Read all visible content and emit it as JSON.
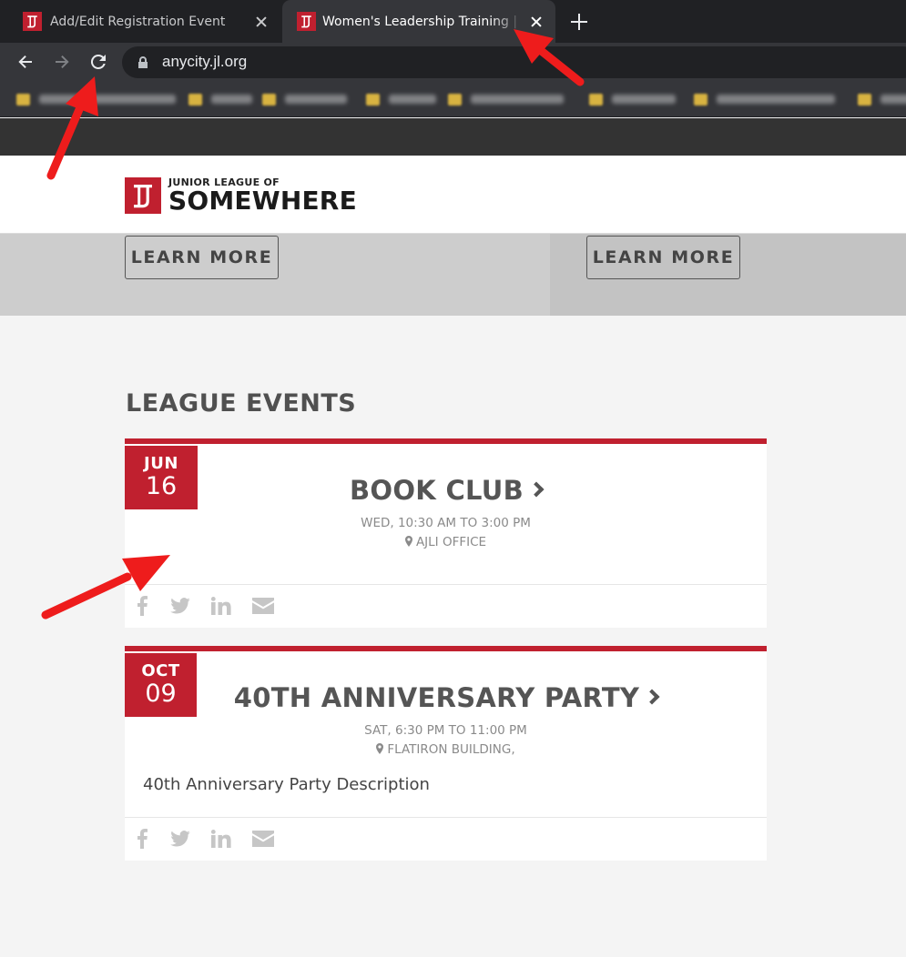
{
  "browser": {
    "tabs": [
      {
        "title": "Add/Edit Registration Event",
        "active": false
      },
      {
        "title": "Women's Leadership Training | FL",
        "active": true
      }
    ],
    "url": "anycity.jl.org",
    "bookmarks_blurred": true
  },
  "site": {
    "logo": {
      "line1": "JUNIOR LEAGUE OF",
      "line2": "SOMEWHERE"
    },
    "promo_buttons": [
      "LEARN MORE",
      "LEARN MORE"
    ],
    "events_heading": "LEAGUE EVENTS",
    "events": [
      {
        "month": "JUN",
        "day": "16",
        "title": "BOOK CLUB",
        "time": "WED, 10:30 AM TO 3:00 PM",
        "location": "AJLI OFFICE",
        "description": ""
      },
      {
        "month": "OCT",
        "day": "09",
        "title": "40TH ANNIVERSARY PARTY",
        "time": "SAT, 6:30 PM TO 11:00 PM",
        "location": "FLATIRON BUILDING,",
        "description": "40th Anniversary Party Description"
      }
    ],
    "share_icons": [
      "facebook-icon",
      "twitter-icon",
      "linkedin-icon",
      "email-icon"
    ]
  },
  "colors": {
    "brand_red": "#c0202f",
    "tabbar_bg": "#202124",
    "toolbar_bg": "#35363a",
    "annotation_arrow": "#ee1c1c"
  }
}
